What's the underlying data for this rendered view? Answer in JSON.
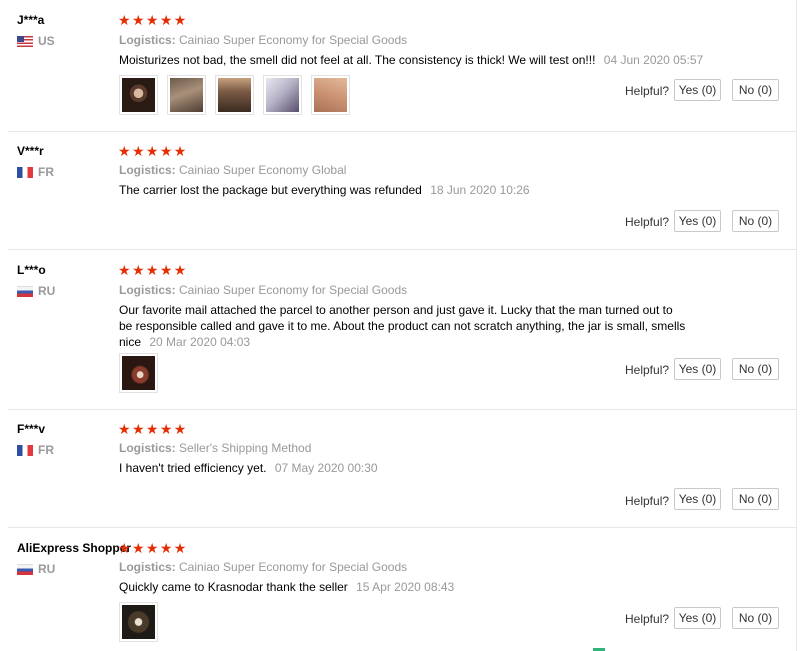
{
  "helpful_label": "Helpful?",
  "reviews": [
    {
      "user": "J***a",
      "country": "US",
      "stars": "★★★★★",
      "logistics_label": "Logistics:",
      "logistics": "Cainiao Super Economy for Special Goods",
      "text": "Moisturizes not bad, the smell did not feel at all. The consistency is thick! We will test on!!!",
      "date": "04 Jun 2020 05:57",
      "yes": "Yes (0)",
      "no": "No (0)"
    },
    {
      "user": "V***r",
      "country": "FR",
      "stars": "★★★★★",
      "logistics_label": "Logistics:",
      "logistics": "Cainiao Super Economy Global",
      "text": "The carrier lost the package but everything was refunded",
      "date": "18 Jun 2020 10:26",
      "yes": "Yes (0)",
      "no": "No (0)"
    },
    {
      "user": "L***o",
      "country": "RU",
      "stars": "★★★★★",
      "logistics_label": "Logistics:",
      "logistics": "Cainiao Super Economy for Special Goods",
      "text": "Our favorite mail attached the parcel to another person and just gave it. Lucky that the man turned out to be responsible called and gave it to me. About the product can not scratch anything, the jar is small, smells nice",
      "date": "20 Mar 2020 04:03",
      "yes": "Yes (0)",
      "no": "No (0)"
    },
    {
      "user": "F***v",
      "country": "FR",
      "stars": "★★★★★",
      "logistics_label": "Logistics:",
      "logistics": "Seller's Shipping Method",
      "text": "I haven't tried efficiency yet.",
      "date": "07 May 2020 00:30",
      "yes": "Yes (0)",
      "no": "No (0)"
    },
    {
      "user": "AliExpress Shopper",
      "country": "RU",
      "stars": "★★★★★",
      "logistics_label": "Logistics:",
      "logistics": "Cainiao Super Economy for Special Goods",
      "text": "Quickly came to Krasnodar thank the seller",
      "date": "15 Apr 2020 08:43",
      "yes": "Yes (0)",
      "no": "No (0)"
    }
  ]
}
